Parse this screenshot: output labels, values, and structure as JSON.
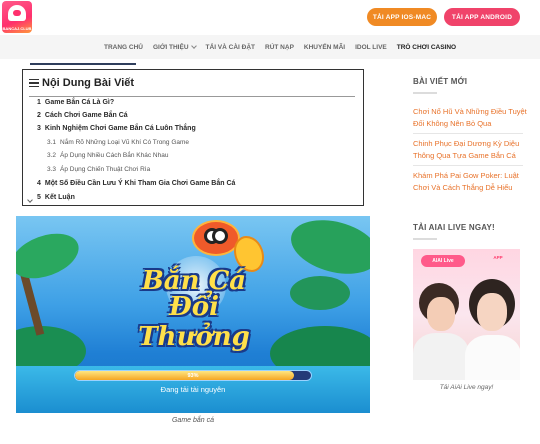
{
  "header": {
    "logo_text": "BANCAJ.CLUB",
    "btn_ios": "TẢI APP IOS-MAC",
    "btn_android": "TẢI APP ANDROID"
  },
  "nav": {
    "items": [
      {
        "label": "TRANG CHỦ",
        "dropdown": false
      },
      {
        "label": "GIỚI THIỆU",
        "dropdown": true
      },
      {
        "label": "TẢI VÀ CÀI ĐẶT",
        "dropdown": false
      },
      {
        "label": "RÚT NẠP",
        "dropdown": false
      },
      {
        "label": "KHUYẾN MÃI",
        "dropdown": false
      },
      {
        "label": "IDOL LIVE",
        "dropdown": false
      },
      {
        "label": "TRÒ CHƠI CASINO",
        "dropdown": false
      }
    ]
  },
  "toc": {
    "title": "Nội Dung Bài Viết",
    "items": [
      {
        "num": "1",
        "text": "Game Bắn Cá Là Gì?",
        "level": 1
      },
      {
        "num": "2",
        "text": "Cách Chơi Game Bắn Cá",
        "level": 1
      },
      {
        "num": "3",
        "text": "Kinh Nghiệm Chơi Game Bắn Cá Luôn Thắng",
        "level": 1
      },
      {
        "num": "3.1",
        "text": "Nắm Rõ Những Loại Vũ Khí Có Trong Game",
        "level": 2
      },
      {
        "num": "3.2",
        "text": "Áp Dụng Nhiều Cách Bắn Khác Nhau",
        "level": 2
      },
      {
        "num": "3.3",
        "text": "Áp Dụng Chiến Thuật Chơi Rìa",
        "level": 2
      },
      {
        "num": "4",
        "text": "Một Số Điều Cần Lưu Ý Khi Tham Gia Chơi Game Bắn Cá",
        "level": 1
      },
      {
        "num": "5",
        "text": "Kết Luận",
        "level": 1
      }
    ]
  },
  "hero": {
    "title_line1": "Bắn Cá",
    "title_line2": "Đổi Thưởng",
    "progress_label": "93%",
    "progress_value": 0.93,
    "loading_text": "Đang tải tài nguyên",
    "caption": "Game bắn cá"
  },
  "sidebar": {
    "recent_heading": "BÀI VIẾT MỚI",
    "posts": [
      "Chơi Nổ Hũ Và Những Điều Tuyệt Đối Không Nên Bỏ Qua",
      "Chinh Phục Đại Dương Kỳ Diệu Thông Qua Tựa Game Bắn Cá",
      "Khám Phá Pai Gow Poker: Luật Chơi Và Cách Thắng Dễ Hiểu"
    ],
    "download_heading": "TẢI AIAI LIVE NGAY!",
    "promo_logo": "AIAI Live",
    "promo_logo_sub": "APP",
    "promo_caption": "Tải AiAi Live ngay!"
  },
  "colors": {
    "ios_button": "#f08a24",
    "android_button": "#f0436a",
    "link_orange": "#e8722a"
  }
}
